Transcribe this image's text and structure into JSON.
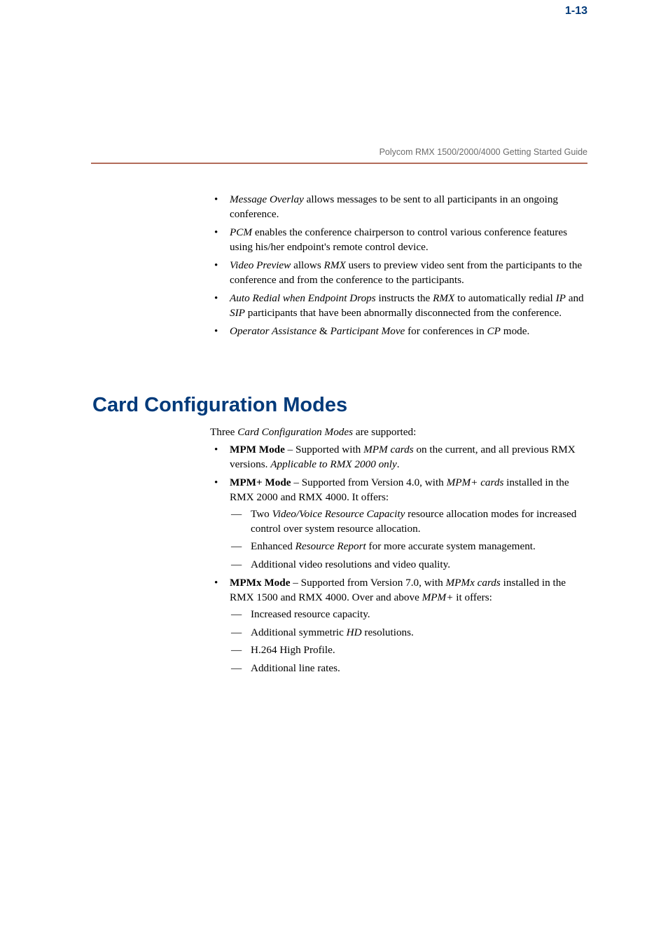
{
  "header": {
    "title": "Polycom RMX 1500/2000/4000 Getting Started Guide"
  },
  "topList": {
    "b1a": "Message Overlay",
    "b1b": " allows messages to be sent to all participants in an ongoing conference.",
    "b2a": "PCM",
    "b2b": " enables the conference chairperson to control various conference features using his/her endpoint's remote control device.",
    "b3a": "Video Preview",
    "b3b": " allows ",
    "b3c": "RMX",
    "b3d": " users to preview video sent from the participants to the conference and from the conference to the participants.",
    "b4a": "Auto Redial when Endpoint Drops",
    "b4b": " instructs the ",
    "b4c": "RMX",
    "b4d": " to automatically redial ",
    "b4e": "IP",
    "b4f": " and ",
    "b4g": "SIP",
    "b4h": " participants that have been abnormally disconnected from the conference.",
    "b5a": "Operator Assistance",
    "b5b": " & ",
    "b5c": "Participant Move",
    "b5d": " for conferences in ",
    "b5e": "CP",
    "b5f": " mode."
  },
  "section": {
    "heading": "Card Configuration Modes",
    "intro1": "Three ",
    "intro2": "Card Configuration Modes",
    "intro3": " are supported:",
    "m1a": "MPM Mode",
    "m1b": " – Supported with ",
    "m1c": "MPM cards",
    "m1d": " on the current, and all previous RMX versions. ",
    "m1e": "Applicable to RMX 2000 only",
    "m1f": ".",
    "m2a": "MPM+ Mode",
    "m2b": " – Supported from Version 4.0, with ",
    "m2c": "MPM+ cards",
    "m2d": " installed in the RMX 2000 and RMX 4000. It offers:",
    "m2s1a": "Two ",
    "m2s1b": "Video/Voice Resource Capacity",
    "m2s1c": " resource allocation modes for increased control over system resource allocation.",
    "m2s2a": "Enhanced ",
    "m2s2b": "Resource Report",
    "m2s2c": " for more accurate system management.",
    "m2s3": "Additional video resolutions and video quality.",
    "m3a": "MPMx Mode",
    "m3b": " – Supported from Version 7.0, with ",
    "m3c": "MPMx cards",
    "m3d": " installed in the RMX 1500 and RMX 4000. Over and above ",
    "m3e": "MPM+",
    "m3f": " it offers:",
    "m3s1": "Increased resource capacity.",
    "m3s2a": "Additional symmetric ",
    "m3s2b": "HD",
    "m3s2c": " resolutions.",
    "m3s3": "H.264 High Profile.",
    "m3s4": "Additional line rates."
  },
  "pageNumber": "1-13"
}
